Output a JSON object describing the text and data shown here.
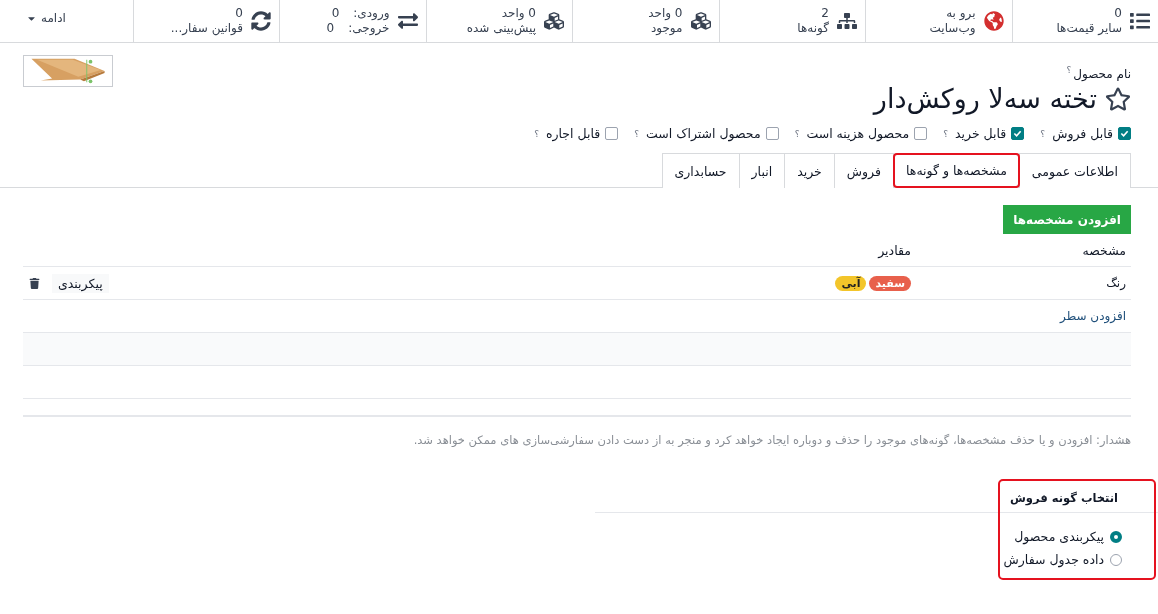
{
  "stat_buttons": [
    {
      "kind": "stat",
      "value": "0",
      "label": "سایر قیمت‌ها"
    },
    {
      "kind": "stat",
      "value": "برو به",
      "label": "وب‌سایت"
    },
    {
      "kind": "stat",
      "value": "2",
      "label": "گونه‌ها"
    },
    {
      "kind": "stat",
      "value": "0 واحد",
      "label": "موجود"
    },
    {
      "kind": "stat",
      "value": "0 واحد",
      "label": "پیش‌بینی شده"
    },
    {
      "kind": "pair",
      "rows": [
        {
          "label": "ورودی:",
          "value": "0"
        },
        {
          "label": "خروجی:",
          "value": "0"
        }
      ]
    },
    {
      "kind": "stat",
      "value": "0",
      "label": "قوانین سفار..."
    }
  ],
  "more_button": {
    "label": "ادامه"
  },
  "product": {
    "name_label": "نام محصول",
    "help": "؟",
    "name": "تخته سه‌لا روکش‌دار",
    "favorite": false
  },
  "options": [
    {
      "label": "قابل فروش",
      "help": "؟",
      "checked": true
    },
    {
      "label": "قابل خرید",
      "help": "؟",
      "checked": true
    },
    {
      "label": "محصول هزینه است",
      "help": "؟",
      "checked": false
    },
    {
      "label": "محصول اشتراک است",
      "help": "؟",
      "checked": false
    },
    {
      "label": "قابل اجاره",
      "help": "؟",
      "checked": false
    }
  ],
  "tabs": [
    {
      "label": "اطلاعات عمومی",
      "selected": false,
      "highlighted": false
    },
    {
      "label": "مشخصه‌ها و گونه‌ها",
      "selected": true,
      "highlighted": true
    },
    {
      "label": "فروش",
      "selected": false,
      "highlighted": false
    },
    {
      "label": "خرید",
      "selected": false,
      "highlighted": false
    },
    {
      "label": "انبار",
      "selected": false,
      "highlighted": false
    },
    {
      "label": "حسابداری",
      "selected": false,
      "highlighted": false
    }
  ],
  "add_attribute_button": {
    "label": "افزودن مشخصه‌ها"
  },
  "table": {
    "columns": [
      "مشخصه",
      "مقادیر"
    ],
    "rows": [
      {
        "attribute": "رنگ",
        "values": [
          {
            "label": "سفید",
            "color": "#e8604c"
          },
          {
            "label": "آبی",
            "color": "#f3c52a"
          }
        ],
        "action": "پیکربندی"
      }
    ],
    "add_line": "افزودن سطر"
  },
  "warning": "هشدار: افزودن و یا حذف مشخصه‌ها، گونه‌های موجود را حذف و دوباره ایجاد خواهد کرد و منجر به از دست دادن سفارشی‌سازی های ممکن خواهد شد.",
  "variant_section": {
    "title": "انتخاب گونه فروش",
    "highlighted": true,
    "choices": [
      {
        "label": "پیکربندی محصول",
        "selected": true
      },
      {
        "label": "داده جدول سفارش",
        "selected": false
      }
    ]
  }
}
